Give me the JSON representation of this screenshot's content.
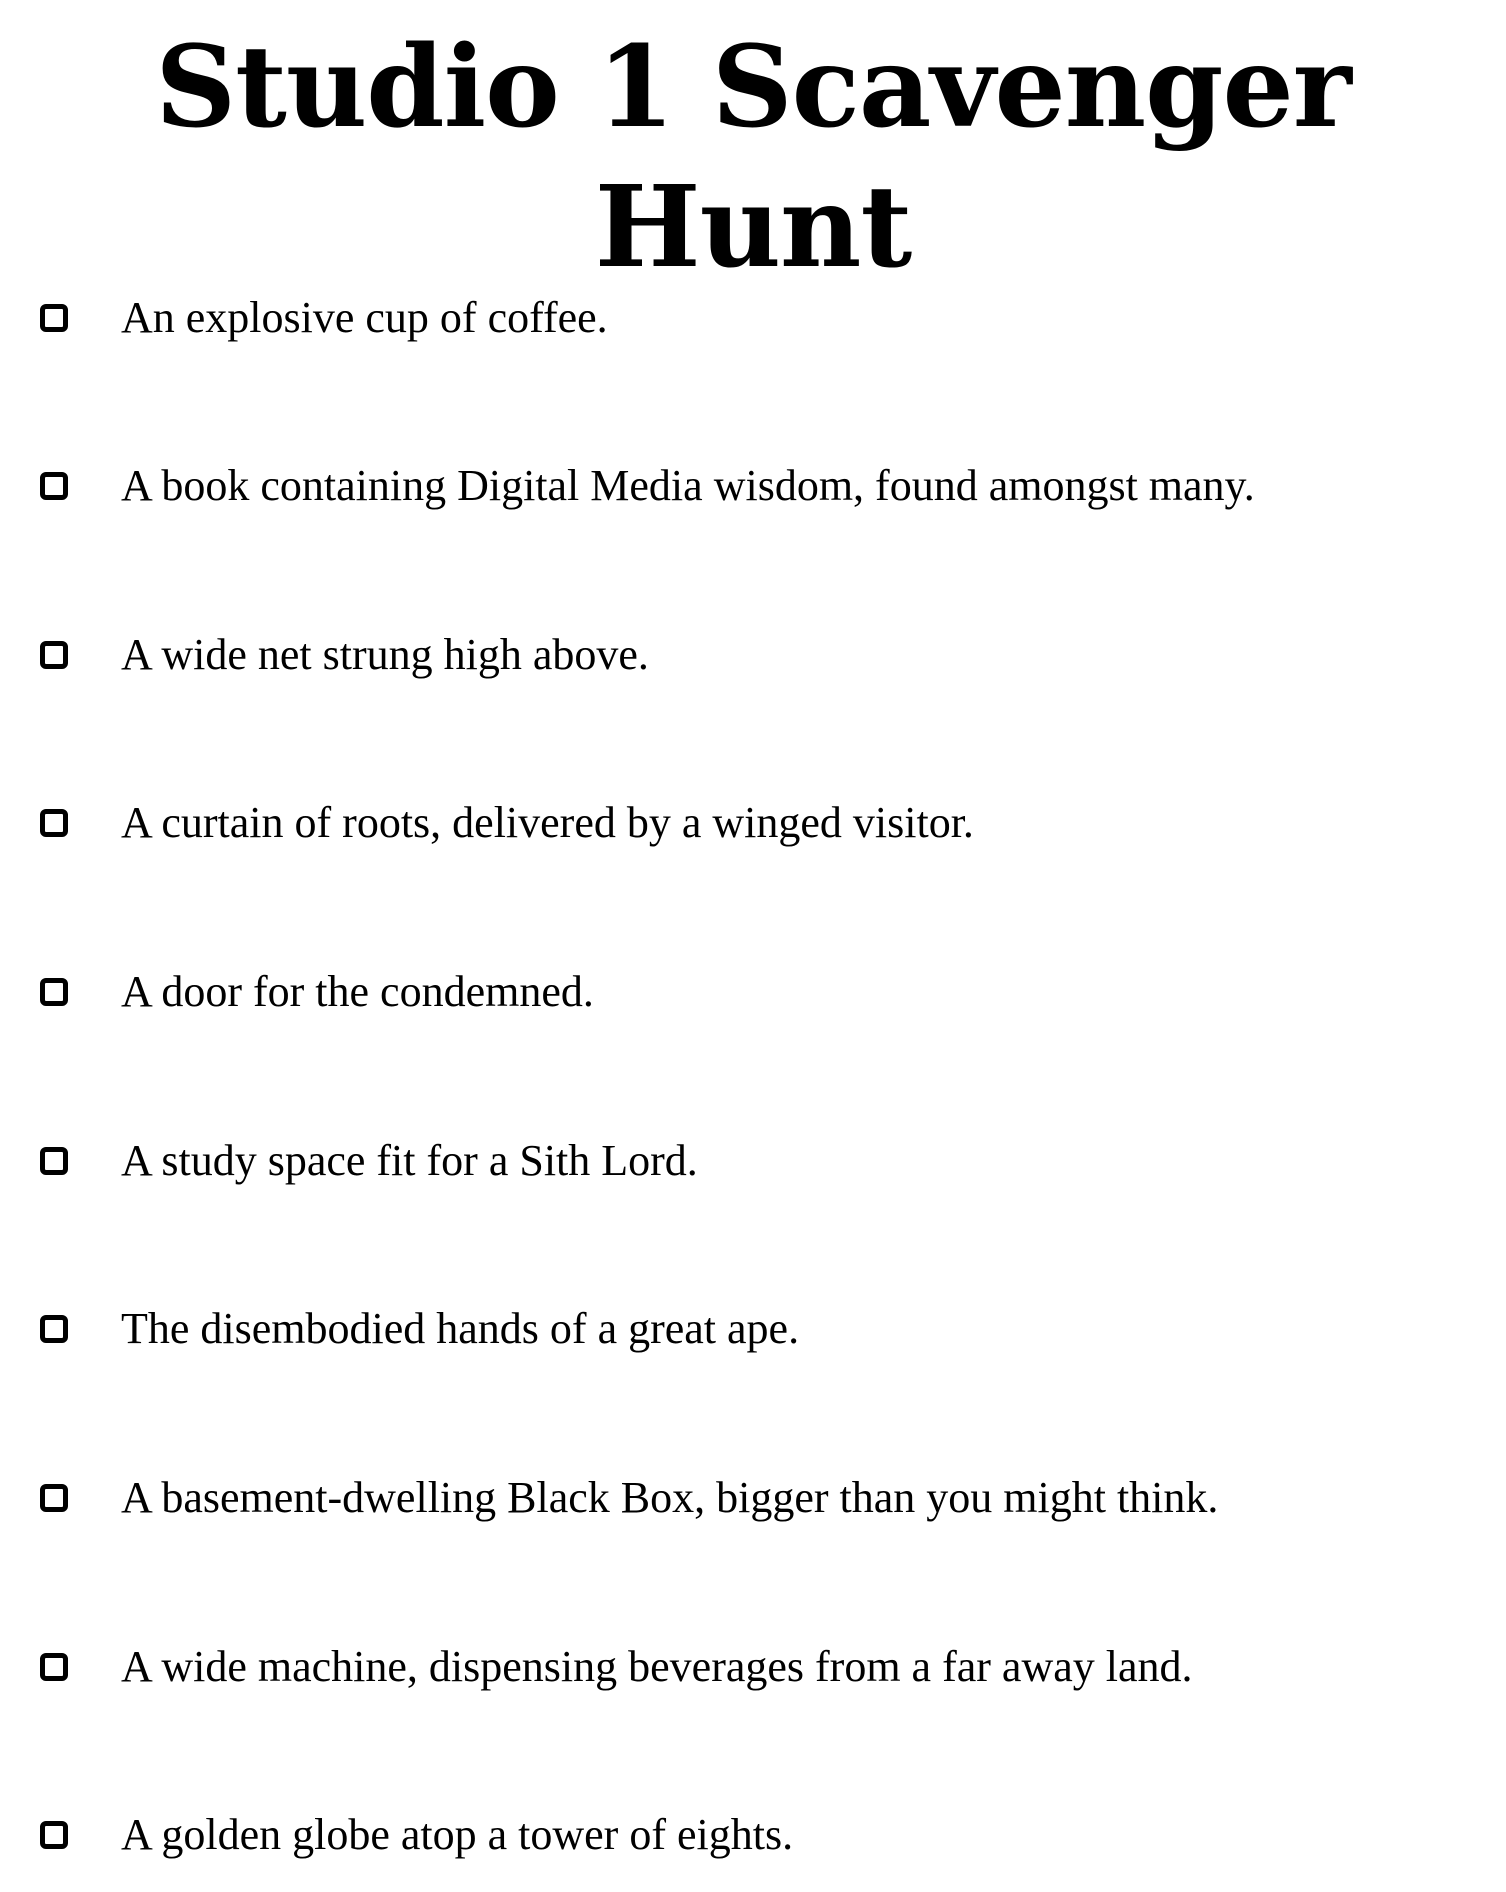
{
  "document": {
    "title": "Studio 1 Scavenger Hunt"
  },
  "checklist": {
    "items": [
      {
        "text": "An explosive cup of coffee.",
        "checked": false
      },
      {
        "text": "A book containing Digital Media wisdom, found amongst many.",
        "checked": false
      },
      {
        "text": "A wide net strung high above.",
        "checked": false
      },
      {
        "text": "A curtain of roots, delivered by a winged visitor.",
        "checked": false
      },
      {
        "text": "A door for the condemned.",
        "checked": false
      },
      {
        "text": "A study space fit for a Sith Lord.",
        "checked": false
      },
      {
        "text": "The disembodied hands of a great ape.",
        "checked": false
      },
      {
        "text": "A basement-dwelling Black Box, bigger than you might think.",
        "checked": false
      },
      {
        "text": "A wide machine, dispensing beverages from a far away land.",
        "checked": false
      },
      {
        "text": "A golden globe atop a tower of eights.",
        "checked": false
      }
    ]
  }
}
